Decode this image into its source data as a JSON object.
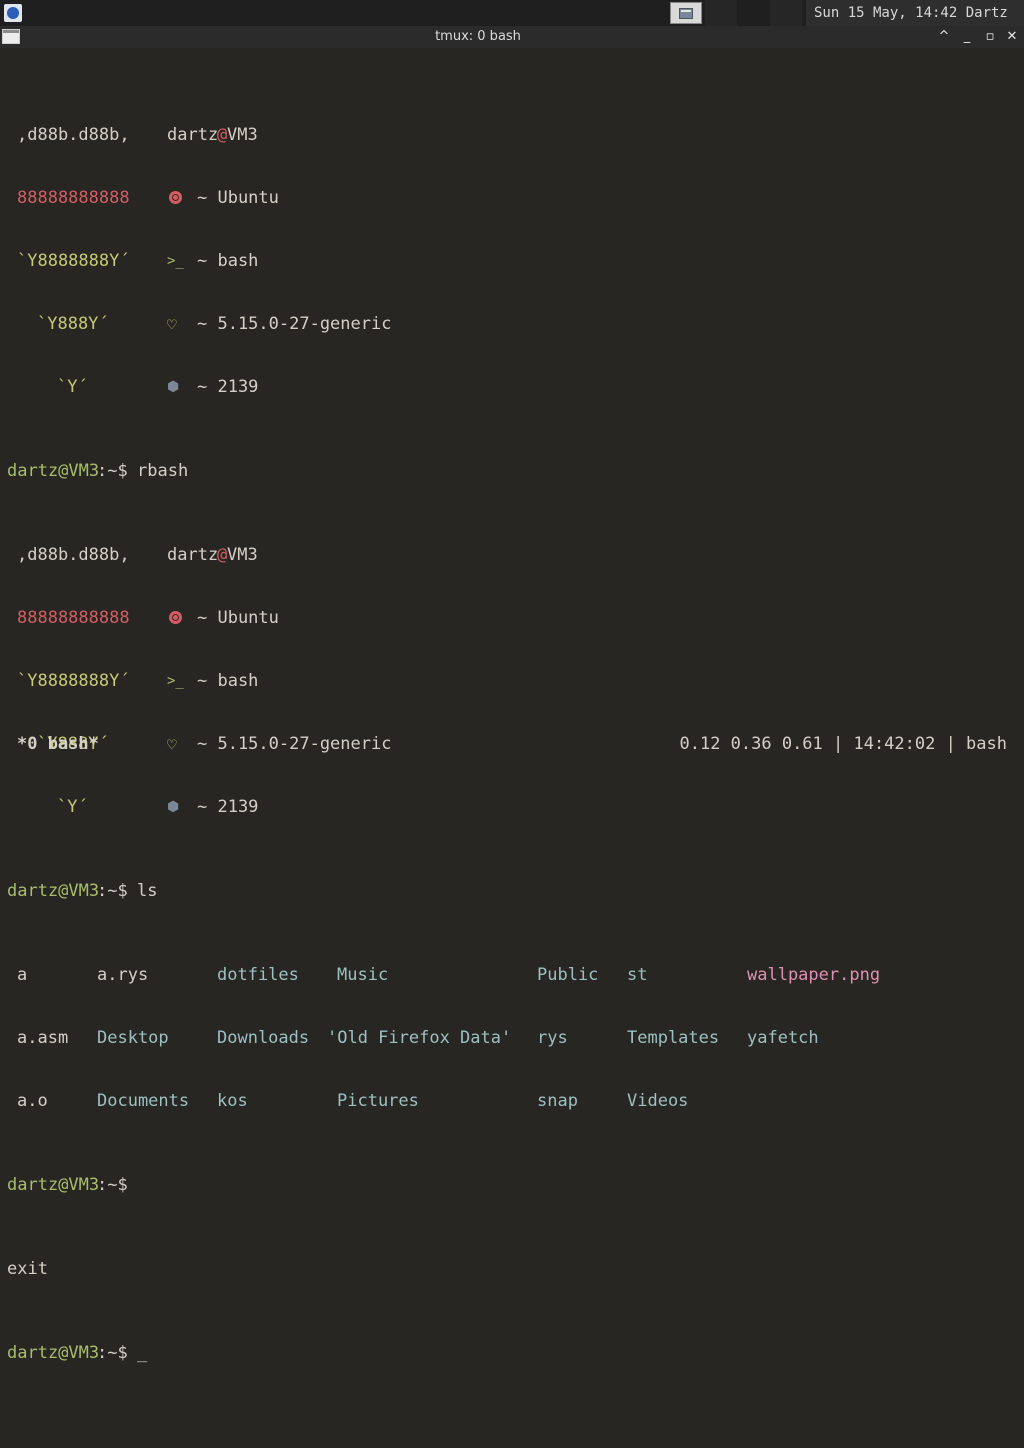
{
  "topbar": {
    "clock": "Sun 15 May, 14:42 Dartz"
  },
  "window": {
    "title": "tmux: 0 bash",
    "controls": [
      "^",
      "_",
      "▫",
      "✕"
    ]
  },
  "colors": {
    "background": "#282623",
    "prompt_user": "#a8bd6b",
    "logo_red": "#d25e63",
    "logo_yellow": "#c3cb74",
    "dir_blue": "#9cc0c1",
    "image_pink": "#df8fb1"
  },
  "fetch1": {
    "logo": [
      ",d88b.d88b,",
      "88888888888",
      "`Y8888888Y´",
      "`Y888Y´",
      "`Y´"
    ],
    "user": "dartz",
    "at": "@",
    "host": "VM3",
    "os": "~ Ubuntu",
    "shell": "~ bash",
    "kernel": "~ 5.15.0-27-generic",
    "packages": "~ 2139"
  },
  "fetch2": {
    "logo": [
      ",d88b.d88b,",
      "88888888888",
      "`Y8888888Y´",
      "`Y888Y´",
      "`Y´"
    ],
    "user": "dartz",
    "at": "@",
    "host": "VM3",
    "os": "~ Ubuntu",
    "shell": "~ bash",
    "kernel": "~ 5.15.0-27-generic",
    "packages": "~ 2139"
  },
  "prompt": {
    "text": "dartz@VM3",
    "sep": ":~$"
  },
  "commands": {
    "c1": "rbash",
    "c2": "ls",
    "c3": "",
    "c4": "",
    "exit": "exit"
  },
  "ls": {
    "col1": [
      "a",
      "a.asm",
      "a.o"
    ],
    "col2": [
      "a.rys",
      "Desktop",
      "Documents"
    ],
    "col3": [
      "dotfiles",
      "Downloads",
      "kos"
    ],
    "col4": [
      "Music",
      "'Old Firefox Data'",
      "Pictures"
    ],
    "col5": [
      "Public",
      "rys",
      "snap"
    ],
    "col6": [
      "st",
      "Templates",
      "Videos"
    ],
    "col7": [
      "wallpaper.png",
      "yafetch"
    ]
  },
  "cursor": "_",
  "status": {
    "left": "*0 bash*",
    "right": "0.12 0.36 0.61 | 14:42:02 | bash"
  }
}
